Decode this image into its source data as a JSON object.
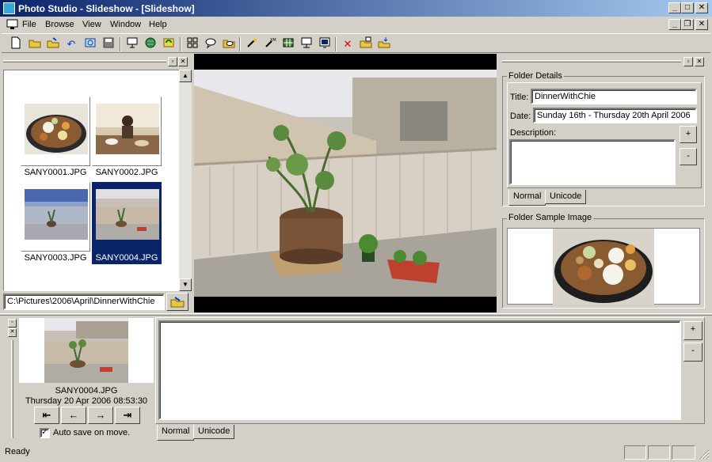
{
  "window": {
    "title": "Photo Studio - Slideshow - [Slideshow]",
    "controls": {
      "minimize": "_",
      "maximize": "□",
      "close": "✕"
    }
  },
  "menu": {
    "items": [
      {
        "label": "File"
      },
      {
        "label": "Browse"
      },
      {
        "label": "View"
      },
      {
        "label": "Window"
      },
      {
        "label": "Help"
      }
    ]
  },
  "toolbar": {
    "icons": [
      "new-icon",
      "open-folder-icon",
      "open-icon",
      "undo-icon",
      "scan-icon",
      "save-icon",
      "slideshow-icon",
      "web-icon",
      "refresh-icon",
      "thumbnails-icon",
      "comment-icon",
      "folder-comment-icon",
      "wand-icon",
      "xml-wand-icon",
      "grid-icon",
      "presentation-icon",
      "screen-icon",
      "delete-icon",
      "copy-icon",
      "move-icon"
    ]
  },
  "thumbnails": [
    {
      "filename": "SANY0001.JPG",
      "selected": false
    },
    {
      "filename": "SANY0002.JPG",
      "selected": false
    },
    {
      "filename": "SANY0003.JPG",
      "selected": false
    },
    {
      "filename": "SANY0004.JPG",
      "selected": true
    }
  ],
  "path": {
    "value": "C:\\Pictures\\2006\\April\\DinnerWithChie"
  },
  "folder_details": {
    "group_label": "Folder Details",
    "title_label": "Title:",
    "title_value": "DinnerWithChie",
    "date_label": "Date:",
    "date_value": "Sunday 16th - Thursday 20th April 2006",
    "description_label": "Description:",
    "description_value": "",
    "plus": "+",
    "minus": "-",
    "tabs": [
      {
        "label": "Normal",
        "active": true
      },
      {
        "label": "Unicode",
        "active": false
      }
    ]
  },
  "sample_image": {
    "group_label": "Folder Sample Image"
  },
  "preview": {
    "filename": "SANY0004.JPG",
    "datetime": "Thursday 20 Apr 2006 08:53:30",
    "auto_save_label": "Auto save on move.",
    "auto_save_checked": true
  },
  "comment": {
    "value": "",
    "plus": "+",
    "minus": "-",
    "tabs": [
      {
        "label": "Normal",
        "active": true
      },
      {
        "label": "Unicode",
        "active": false
      }
    ]
  },
  "status": {
    "text": "Ready"
  }
}
